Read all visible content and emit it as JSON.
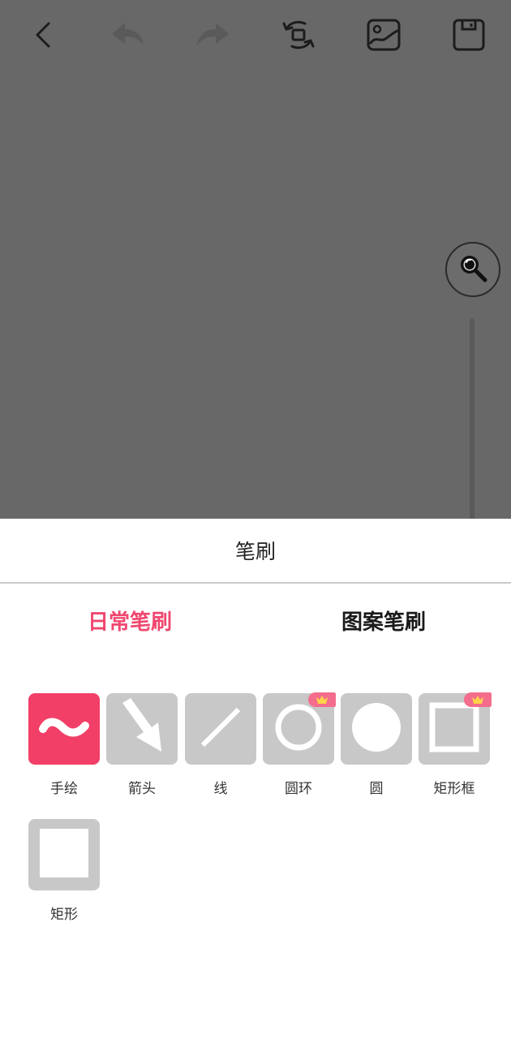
{
  "sheet": {
    "title": "笔刷",
    "tabs": [
      {
        "label": "日常笔刷",
        "active": true
      },
      {
        "label": "图案笔刷",
        "active": false
      }
    ],
    "brushes": [
      {
        "label": "手绘",
        "icon": "freehand-wave-icon",
        "selected": true,
        "vip": false
      },
      {
        "label": "箭头",
        "icon": "arrow-icon",
        "selected": false,
        "vip": false
      },
      {
        "label": "线",
        "icon": "line-icon",
        "selected": false,
        "vip": false
      },
      {
        "label": "圆环",
        "icon": "ring-icon",
        "selected": false,
        "vip": true
      },
      {
        "label": "圆",
        "icon": "circle-icon",
        "selected": false,
        "vip": false
      },
      {
        "label": "矩形框",
        "icon": "rect-frame-icon",
        "selected": false,
        "vip": true
      },
      {
        "label": "矩形",
        "icon": "rect-icon",
        "selected": false,
        "vip": false
      }
    ]
  },
  "toolbar": {
    "icons": [
      "back-icon",
      "undo-icon",
      "redo-icon",
      "rotate-icon",
      "image-icon",
      "save-icon"
    ]
  },
  "colors": {
    "accent": "#f0476f",
    "canvas": "#686868",
    "tile": "#c8c8c8",
    "selected_tile": "#f23f68"
  }
}
